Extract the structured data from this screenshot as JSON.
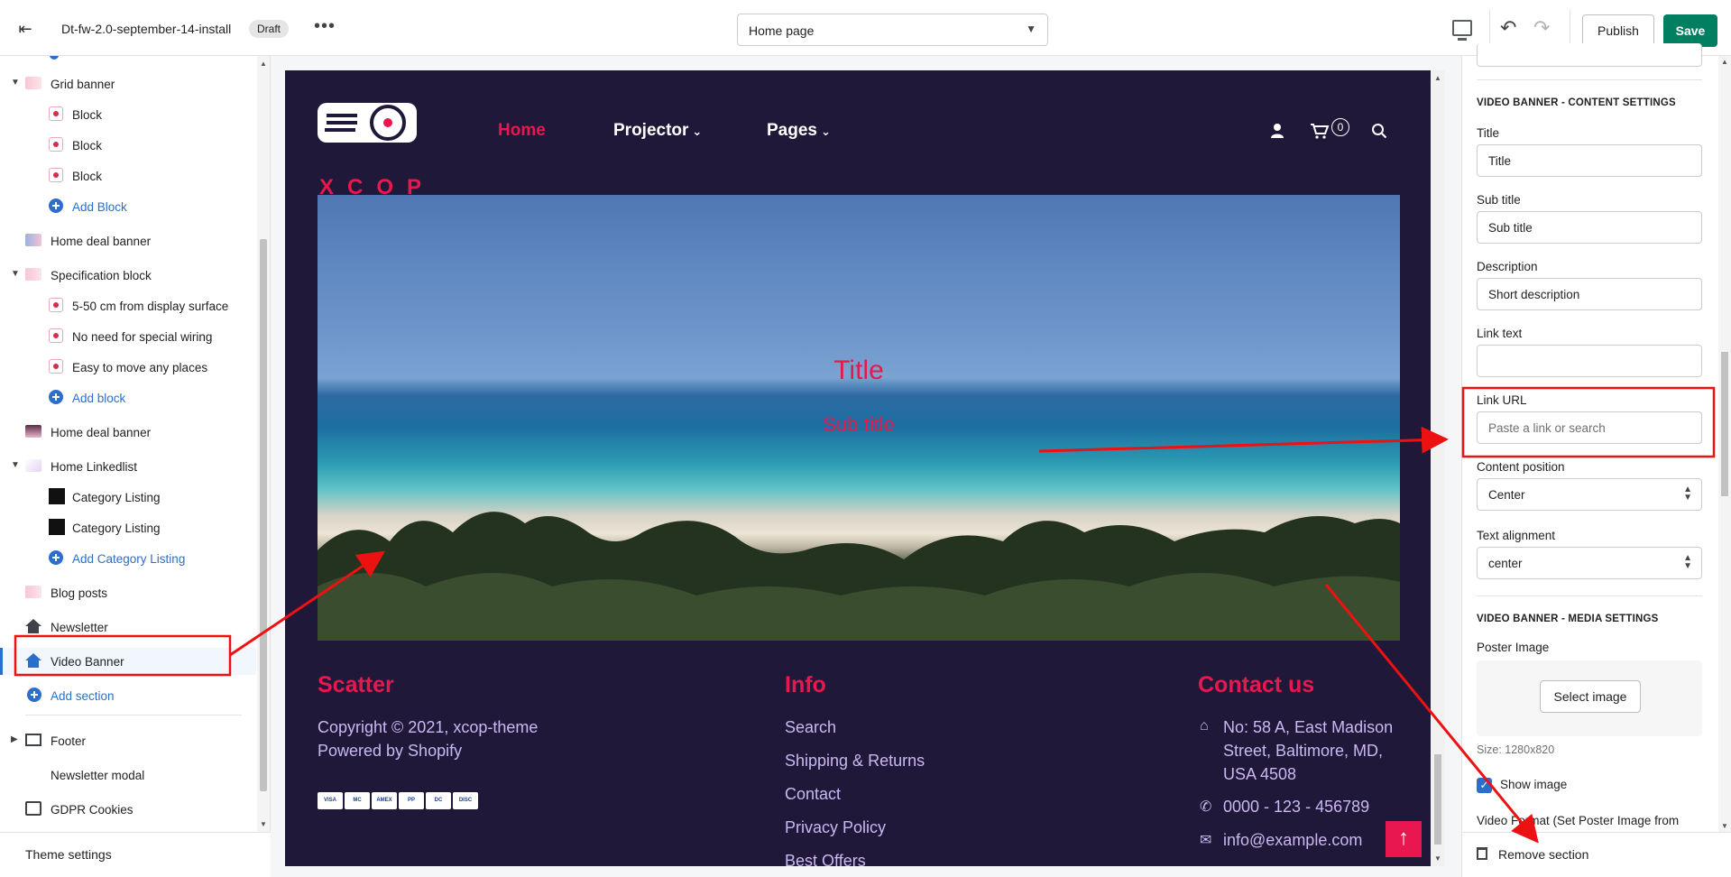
{
  "topbar": {
    "theme_name": "Dt-fw-2.0-september-14-install",
    "status": "Draft",
    "more": "•••",
    "page_select": "Home page",
    "publish": "Publish",
    "save": "Save",
    "undo": "↶",
    "redo": "↷",
    "exit": "⇤"
  },
  "sidebar": {
    "items": [
      {
        "label": "Grid banner",
        "type": "section"
      },
      {
        "label": "Block",
        "type": "block"
      },
      {
        "label": "Block",
        "type": "block"
      },
      {
        "label": "Block",
        "type": "block"
      },
      {
        "label": "Add Block",
        "type": "add"
      },
      {
        "label": "Home deal banner",
        "type": "section"
      },
      {
        "label": "Specification block",
        "type": "section"
      },
      {
        "label": "5-50 cm from display surface",
        "type": "block"
      },
      {
        "label": "No need for special wiring",
        "type": "block"
      },
      {
        "label": "Easy to move any places",
        "type": "block"
      },
      {
        "label": "Add block",
        "type": "add"
      },
      {
        "label": "Home deal banner",
        "type": "section"
      },
      {
        "label": "Home Linkedlist",
        "type": "section"
      },
      {
        "label": "Category Listing",
        "type": "block"
      },
      {
        "label": "Category Listing",
        "type": "block"
      },
      {
        "label": "Add Category Listing",
        "type": "add"
      },
      {
        "label": "Blog posts",
        "type": "section"
      },
      {
        "label": "Newsletter",
        "type": "section"
      },
      {
        "label": "Video Banner",
        "type": "section",
        "selected": true
      },
      {
        "label": "Add section",
        "type": "add"
      },
      {
        "label": "Footer",
        "type": "section"
      },
      {
        "label": "Newsletter modal",
        "type": "section"
      },
      {
        "label": "GDPR Cookies",
        "type": "section"
      }
    ],
    "theme_settings": "Theme settings"
  },
  "preview": {
    "logo_text": "XCOP",
    "nav": [
      {
        "label": "Home",
        "active": true
      },
      {
        "label": "Projector",
        "dropdown": true
      },
      {
        "label": "Pages",
        "dropdown": true
      }
    ],
    "cart_count": "0",
    "banner": {
      "title": "Title",
      "subtitle": "Sub title"
    },
    "footer": {
      "col1": {
        "heading": "Scatter",
        "lines": [
          "Copyright © 2021, xcop-theme",
          "Powered by Shopify"
        ]
      },
      "col2": {
        "heading": "Info",
        "links": [
          "Search",
          "Shipping & Returns",
          "Contact",
          "Privacy Policy",
          "Best Offers"
        ]
      },
      "col3": {
        "heading": "Contact us",
        "address": [
          "No: 58 A, East Madison",
          "Street, Baltimore, MD,",
          "USA 4508"
        ],
        "phone": "0000 - 123 - 456789",
        "email": "info@example.com"
      },
      "payment_icons": [
        "VISA",
        "MC",
        "AMEX",
        "PP",
        "DC",
        "DISC"
      ]
    }
  },
  "settings": {
    "content_heading": "VIDEO BANNER - CONTENT SETTINGS",
    "title_label": "Title",
    "title_value": "Title",
    "subtitle_label": "Sub title",
    "subtitle_value": "Sub title",
    "description_label": "Description",
    "description_value": "Short description",
    "link_text_label": "Link text",
    "link_text_value": "",
    "link_url_label": "Link URL",
    "link_url_placeholder": "Paste a link or search",
    "content_position_label": "Content position",
    "content_position_value": "Center",
    "text_alignment_label": "Text alignment",
    "text_alignment_value": "center",
    "media_heading": "VIDEO BANNER - MEDIA SETTINGS",
    "poster_label": "Poster Image",
    "select_image": "Select image",
    "size_note": "Size: 1280x820",
    "show_image_label": "Show image",
    "video_format_label": "Video Format (Set Poster Image from",
    "remove_section": "Remove section"
  },
  "colors": {
    "accent": "#e8174f",
    "save": "#008060",
    "preview_bg": "#201838",
    "annotation": "#ee1111"
  }
}
